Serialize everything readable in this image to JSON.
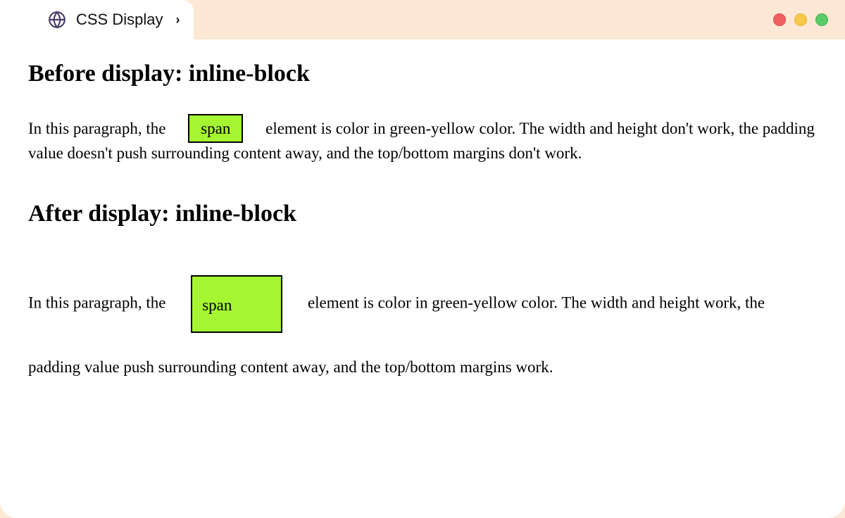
{
  "tab": {
    "title": "CSS Display"
  },
  "section1": {
    "heading": "Before display: inline-block",
    "text_before": "In this paragraph, the ",
    "span_label": "span",
    "text_after": " element is color in green-yellow color. The width and height don't work, the padding value doesn't push surrounding content away, and the top/bottom margins don't work."
  },
  "section2": {
    "heading": "After display: inline-block",
    "text_before": "In this paragraph, the ",
    "span_label": "span",
    "text_after": " element is color in green-yellow color. The width and height work, the padding value push surrounding content away, and the top/bottom margins work."
  }
}
